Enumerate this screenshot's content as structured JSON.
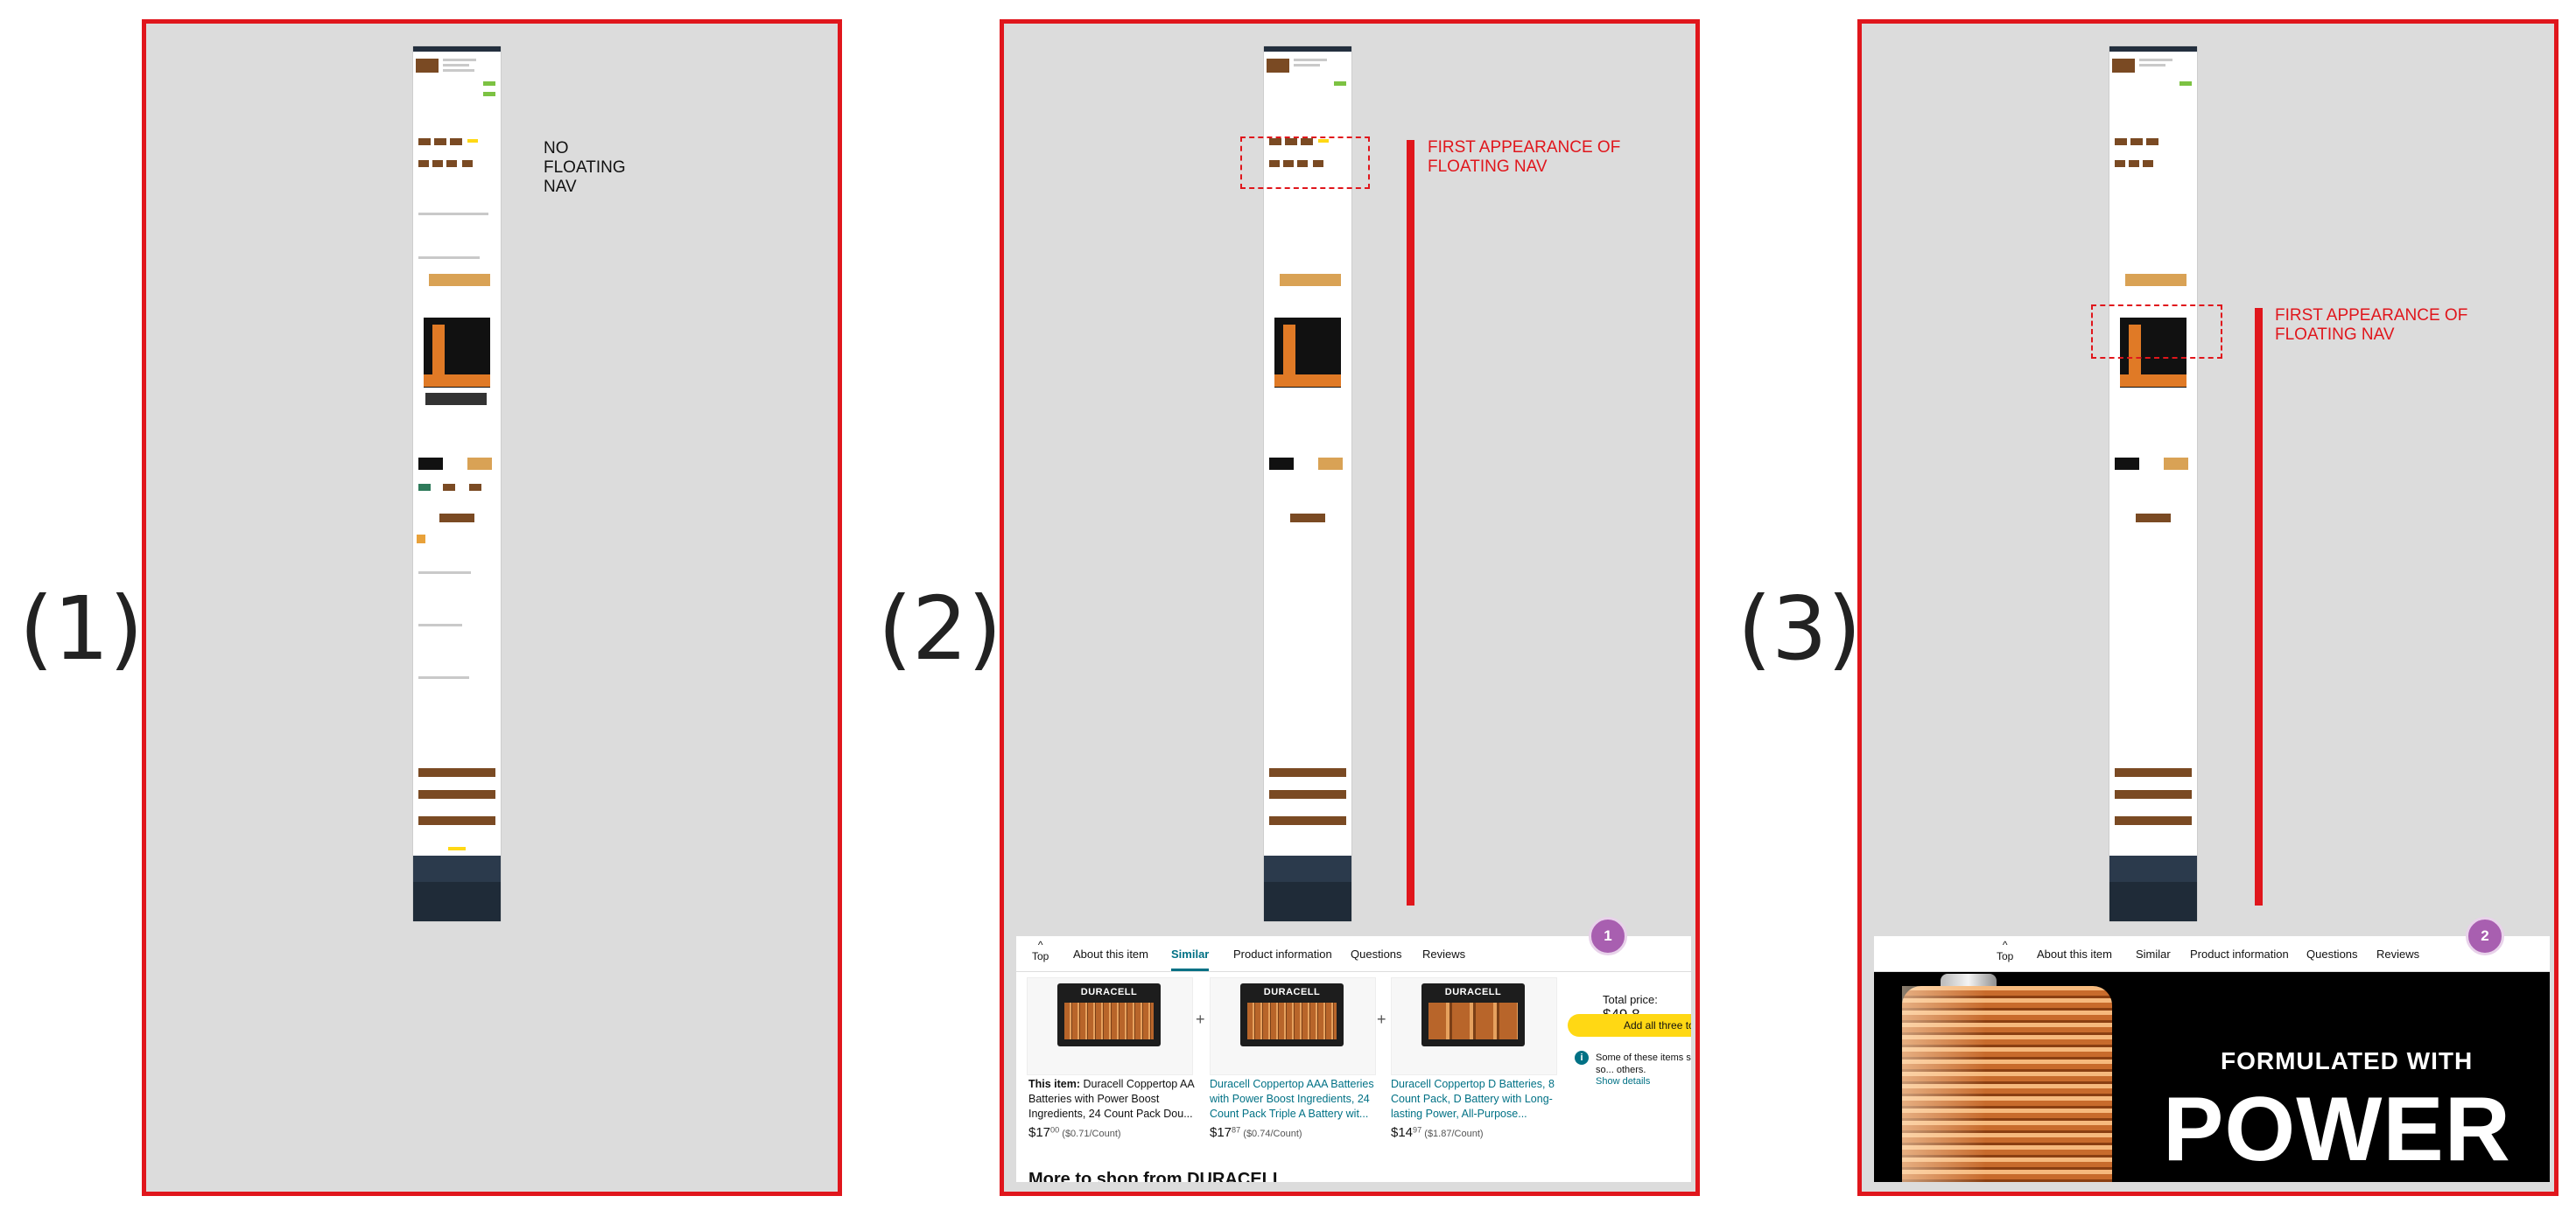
{
  "panels": [
    {
      "number": "(1)",
      "note": [
        "NO",
        "FLOATING",
        "NAV"
      ]
    },
    {
      "number": "(2)",
      "note": [
        "FIRST APPEARANCE OF",
        "FLOATING NAV"
      ],
      "badge": "1"
    },
    {
      "number": "(3)",
      "note": [
        "FIRST APPEARANCE OF",
        "FLOATING NAV"
      ],
      "badge": "2"
    }
  ],
  "nav": {
    "top_arrow": "^",
    "top_label": "Top",
    "tabs": [
      "About this item",
      "Similar",
      "Product information",
      "Questions",
      "Reviews"
    ],
    "active_tab_panel2": "Similar"
  },
  "panel2_content": {
    "items": [
      {
        "brand": "DURACELL",
        "title_prefix": "This item:",
        "title": "Duracell Coppertop AA Batteries with Power Boost Ingredients, 24 Count Pack Dou...",
        "price_dollars": "$17",
        "price_cents": "00",
        "unit_price": "($0.71/Count)"
      },
      {
        "brand": "DURACELL",
        "title": "Duracell Coppertop AAA Batteries with Power Boost Ingredients, 24 Count Pack Triple A Battery wit...",
        "price_dollars": "$17",
        "price_cents": "87",
        "unit_price": "($0.74/Count)"
      },
      {
        "brand": "DURACELL",
        "title": "Duracell Coppertop D Batteries, 8 Count Pack, D Battery with Long-lasting Power, All-Purpose...",
        "price_dollars": "$14",
        "price_cents": "97",
        "unit_price": "($1.87/Count)"
      }
    ],
    "plus": "+",
    "total_label": "Total price:",
    "total_value": "$49.8",
    "add_button": "Add all three to Ca",
    "info_icon": "i",
    "info_text": "Some of these items ship so... others.",
    "show_details": "Show details",
    "more_to_shop": "More to shop from DURACELL"
  },
  "panel3_content": {
    "line1": "FORMULATED WITH",
    "line2": "POWER"
  },
  "colors": {
    "frame_red": "#e0161c",
    "frame_bg": "#dcdcdc",
    "link_teal": "#007185",
    "button_yellow": "#ffd814",
    "badge_purple": "#a85fb0"
  }
}
